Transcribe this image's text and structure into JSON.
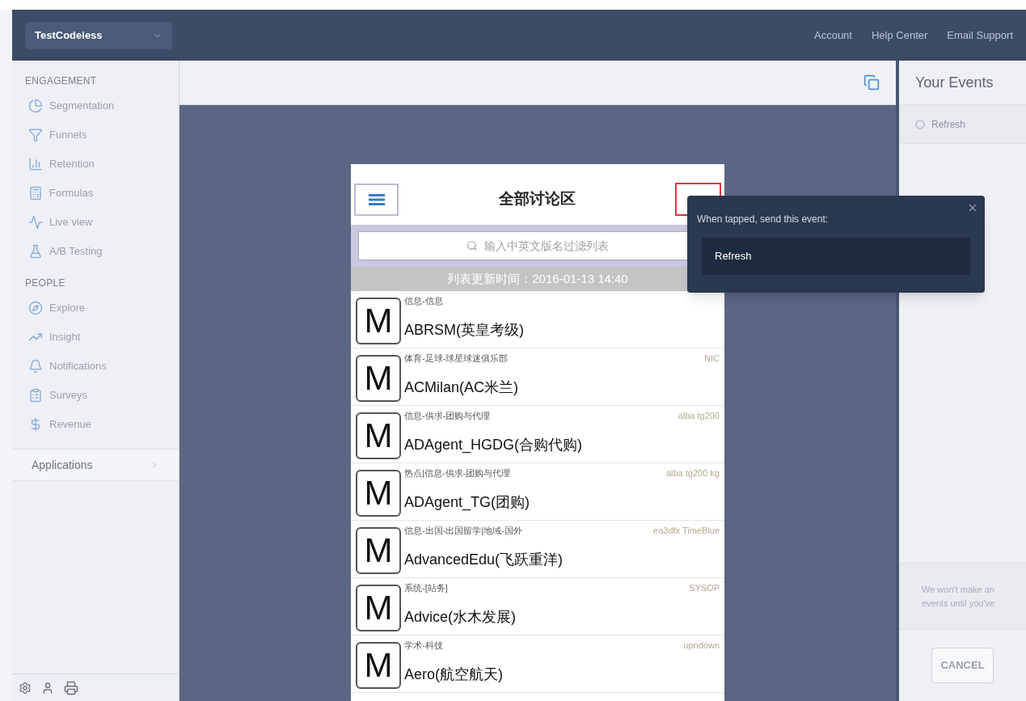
{
  "app_switcher": {
    "label": "TestCodeless"
  },
  "top_links": [
    "Account",
    "Help Center",
    "Email Support"
  ],
  "sidebar": {
    "sections": [
      {
        "title": "ENGAGEMENT",
        "items": [
          {
            "label": "Segmentation",
            "kind": "pie"
          },
          {
            "label": "Funnels",
            "kind": "funnel"
          },
          {
            "label": "Retention",
            "kind": "retention"
          },
          {
            "label": "Formulas",
            "kind": "formula"
          },
          {
            "label": "Live view",
            "kind": "live"
          },
          {
            "label": "A/B Testing",
            "kind": "ab"
          }
        ]
      },
      {
        "title": "PEOPLE",
        "items": [
          {
            "label": "Explore",
            "kind": "explore"
          },
          {
            "label": "Insight",
            "kind": "insight"
          },
          {
            "label": "Notifications",
            "kind": "notify"
          },
          {
            "label": "Surveys",
            "kind": "survey"
          },
          {
            "label": "Revenue",
            "kind": "revenue"
          }
        ]
      }
    ],
    "applications": "Applications"
  },
  "phone": {
    "title": "全部讨论区",
    "search_placeholder": "输入中英文版名过滤列表",
    "updated": "列表更新时间：2016-01-13 14:40",
    "rows": [
      {
        "badge": "M",
        "category": "信息-信息",
        "name": "ABRSM(英皇考级)"
      },
      {
        "badge": "M",
        "category": "体育-足球-球星球迷俱乐部",
        "owner": "NIC",
        "name": "ACMilan(AC米兰)"
      },
      {
        "badge": "M",
        "category": "信息-供求-团购与代理",
        "owner": "alba tg200",
        "name": "ADAgent_HGDG(合购代购)"
      },
      {
        "badge": "M",
        "category": "热点|信息-供求-团购与代理",
        "owner": "alba tg200 kg",
        "name": "ADAgent_TG(团购)"
      },
      {
        "badge": "M",
        "category": "信息-出国-出国留学|地域-国外",
        "owner": "ea3dfx TimeBlue",
        "name": "AdvancedEdu(飞跃重洋)"
      },
      {
        "badge": "M",
        "category": "系统-[站务]",
        "owner": "SYSOP",
        "name": "Advice(水木发展)"
      },
      {
        "badge": "M",
        "category": "学术-科技",
        "owner": "upndown",
        "name": "Aero(航空航天)"
      }
    ]
  },
  "popup": {
    "prompt": "When tapped, send this event:",
    "event": "Refresh"
  },
  "events_panel": {
    "title": "Your Events",
    "events": [
      {
        "label": "Refresh"
      }
    ],
    "note": [
      "We won't make an",
      "events until you've"
    ],
    "cancel": "CANCEL"
  }
}
